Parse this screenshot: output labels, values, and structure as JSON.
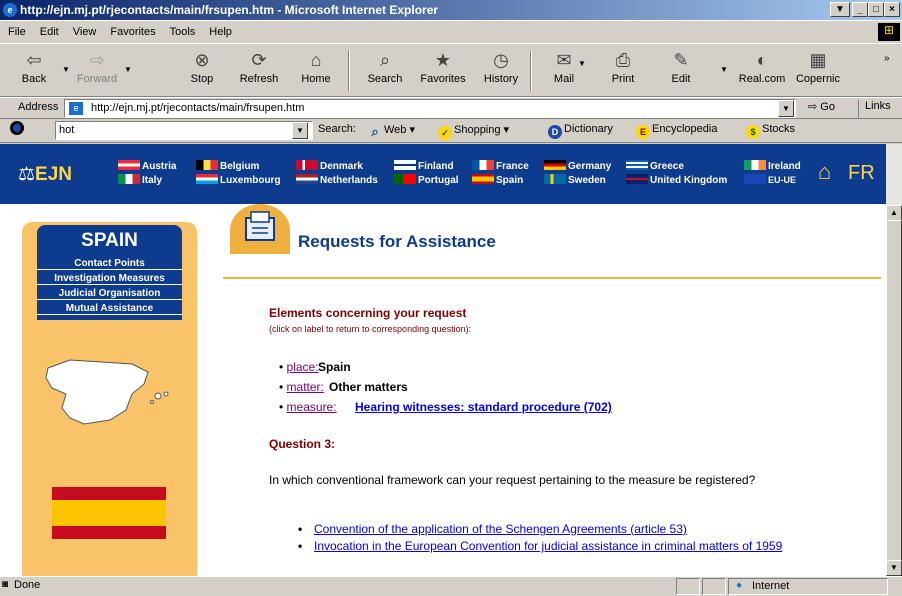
{
  "window": {
    "title": "http://ejn.mj.pt/rjecontacts/main/frsupen.htm - Microsoft Internet Explorer",
    "controls": [
      "▼",
      "_",
      "□",
      "×"
    ]
  },
  "menu": [
    "File",
    "Edit",
    "View",
    "Favorites",
    "Tools",
    "Help"
  ],
  "toolbar": {
    "back": "Back",
    "forward": "Forward",
    "stop": "Stop",
    "refresh": "Refresh",
    "home": "Home",
    "search": "Search",
    "favorites": "Favorites",
    "history": "History",
    "mail": "Mail",
    "print": "Print",
    "edit": "Edit",
    "realcom": "Real.com",
    "copernic": "Copernic"
  },
  "address": {
    "label": "Address",
    "url": "http://ejn.mj.pt/rjecontacts/main/frsupen.htm",
    "go": "Go",
    "links": "Links"
  },
  "searchbar": {
    "query": "hot",
    "search_label": "Search:",
    "web": "Web",
    "shopping": "Shopping",
    "dictionary": "Dictionary",
    "encyclopedia": "Encyclopedia",
    "stocks": "Stocks"
  },
  "banner": {
    "logo": "EJN",
    "countries": [
      "Austria",
      "Italy",
      "Belgium",
      "Luxembourg",
      "Denmark",
      "Netherlands",
      "Finland",
      "Portugal",
      "France",
      "Spain",
      "Germany",
      "Sweden",
      "Greece",
      "United Kingdom",
      "Ireland",
      "EU-UE"
    ],
    "lang": "FR"
  },
  "sidebar": {
    "country": "SPAIN",
    "links": [
      "Contact Points",
      "Investigation Measures",
      "Judicial Organisation",
      "Mutual Assistance"
    ]
  },
  "content": {
    "title": "Requests for Assistance",
    "elements_heading": "Elements concerning your request",
    "elements_note": "(click on label to return to corresponding question):",
    "items": [
      {
        "label": "place:",
        "value": "Spain"
      },
      {
        "label": "matter:",
        "value": "Other matters"
      },
      {
        "label": "measure:",
        "value": "Hearing witnesses: standard procedure (702)"
      }
    ],
    "question_heading": "Question 3:",
    "question_text": "In which conventional framework can your request pertaining to the measure be registered?",
    "options": [
      "Convention of the application of the Schengen Agreements (article 53)",
      "Invocation in the European Convention for judicial assistance in criminal matters of 1959"
    ]
  },
  "status": {
    "text": "Done",
    "zone": "Internet"
  }
}
